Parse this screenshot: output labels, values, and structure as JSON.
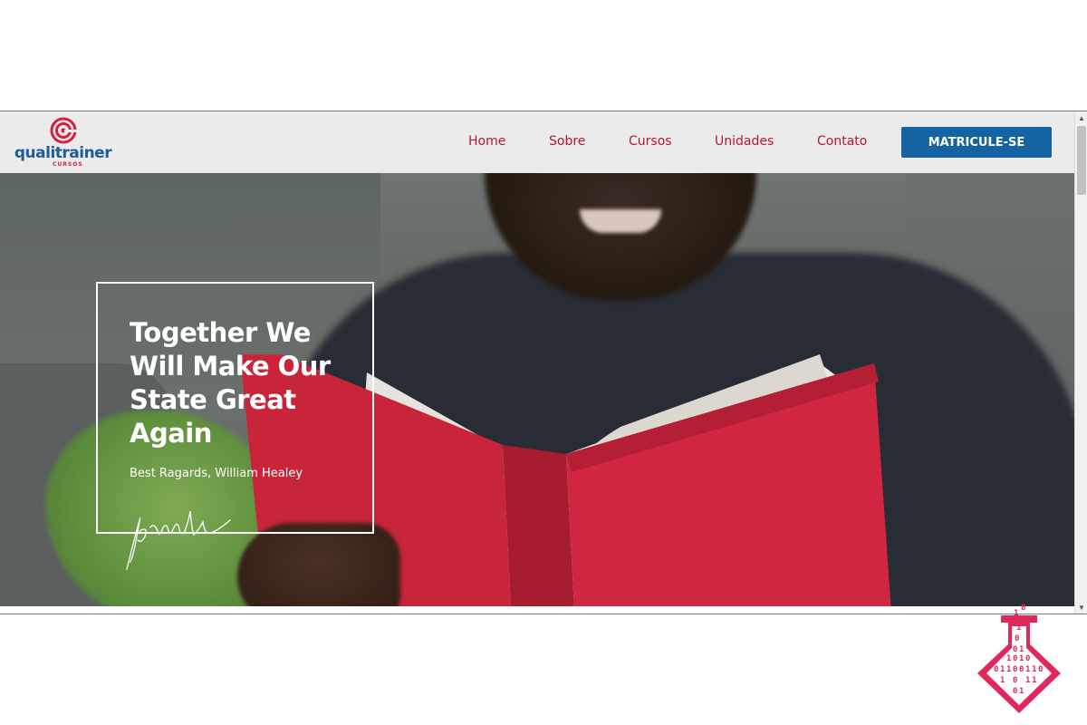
{
  "header": {
    "logo_text": "qualitrainer",
    "logo_subtext": "CURSOS"
  },
  "nav": {
    "items": [
      {
        "label": "Home"
      },
      {
        "label": "Sobre"
      },
      {
        "label": "Cursos"
      },
      {
        "label": "Unidades"
      },
      {
        "label": "Contato"
      }
    ],
    "cta_label": "MATRICULE-SE"
  },
  "hero": {
    "title": "Together We Will Make Our State Great Again",
    "subtitle": "Best Ragards, William Healey"
  },
  "badge": {
    "binary_digits": [
      "0",
      "1",
      "1",
      "0",
      "0",
      "1",
      "1",
      "0",
      "1",
      "0",
      "0",
      "1",
      "1",
      "0",
      "0",
      "1",
      "1",
      "0",
      "1",
      "0",
      "1",
      "1",
      "0",
      "1"
    ]
  },
  "colors": {
    "brand_blue": "#1d5d9a",
    "brand_red": "#d4213d",
    "nav_link": "#b3182e",
    "cta_bg": "#1563a3",
    "header_bg": "#ebebeb",
    "book_red": "#c8243a",
    "badge_pink": "#e0285a"
  }
}
